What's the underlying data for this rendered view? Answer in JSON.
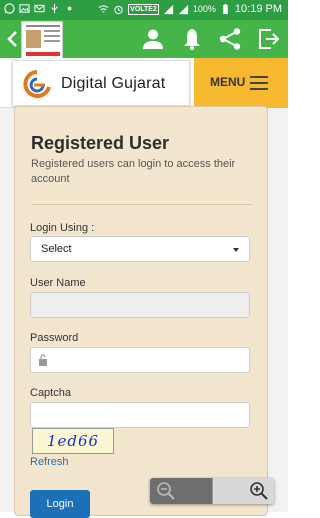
{
  "status_bar": {
    "network": "VOLTE2",
    "battery": "100%",
    "time": "10:19 PM"
  },
  "app_bar": {
    "icons": [
      "back-arrow-icon",
      "profile-icon",
      "notification-bell-icon",
      "share-icon",
      "exit-icon"
    ]
  },
  "header": {
    "logo_text": "Digital Gujarat",
    "menu_label": "MENU"
  },
  "login_card": {
    "title": "Registered User",
    "subtitle": "Registered users can login to access their account",
    "login_using_label": "Login Using :",
    "login_using_value": "Select",
    "username_label": "User Name",
    "username_value": "",
    "password_label": "Password",
    "password_value": "",
    "captcha_label": "Captcha",
    "captcha_value": "",
    "captcha_text": "1ed66",
    "refresh_label": "Refresh",
    "login_button": "Login"
  },
  "colors": {
    "status_bar": "#2e9e45",
    "app_bar": "#45b549",
    "menu_accent": "#f5b82e",
    "card_bg": "#f3e6cf",
    "login_button": "#1d6fb8"
  }
}
